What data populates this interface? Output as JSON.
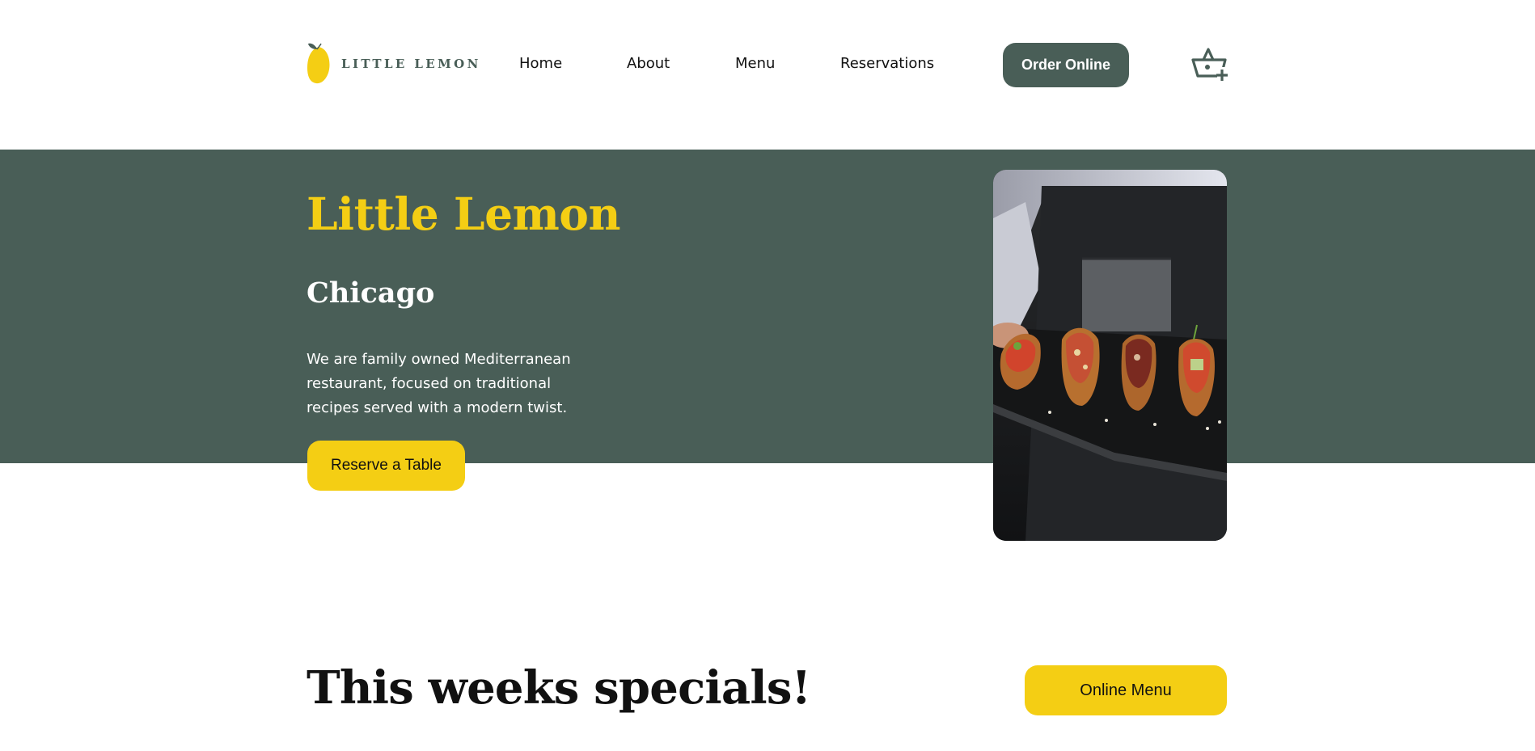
{
  "header": {
    "logo_text": "LITTLE LEMON",
    "nav": [
      "Home",
      "About",
      "Menu",
      "Reservations"
    ],
    "order_button": "Order Online",
    "cart_icon": "basket-add-icon"
  },
  "hero": {
    "title": "Little Lemon",
    "subtitle": "Chicago",
    "description": "We are family owned Mediterranean restaurant, focused on traditional recipes served with a modern twist.",
    "cta": "Reserve a Table",
    "image": "restaurant-food-image"
  },
  "specials": {
    "title": "This weeks specials!",
    "cta": "Online Menu"
  },
  "colors": {
    "primary": "#495e57",
    "accent": "#f4ce14",
    "text": "#111111",
    "background": "#ffffff"
  }
}
